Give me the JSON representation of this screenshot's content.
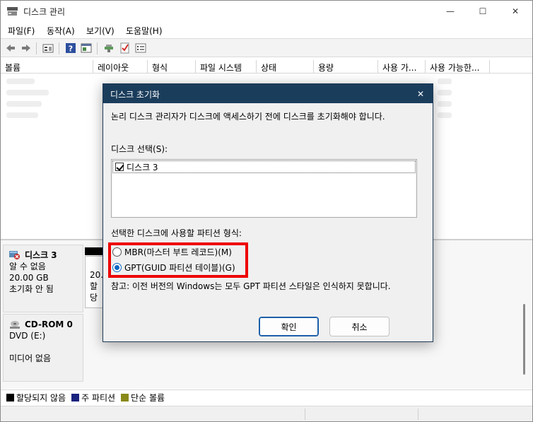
{
  "window": {
    "title": "디스크 관리",
    "min_glyph": "—",
    "max_glyph": "☐",
    "close_glyph": "✕"
  },
  "menu": [
    "파일(F)",
    "동작(A)",
    "보기(V)",
    "도움말(H)"
  ],
  "columns": [
    "볼륨",
    "레이아웃",
    "형식",
    "파일 시스템",
    "상태",
    "용량",
    "사용 가...",
    "사용 가능한..."
  ],
  "disks": [
    {
      "name": "디스크 3",
      "type": "알 수 없음",
      "size": "20.00 GB",
      "state": "초기화 안 됨",
      "icon": "disk-unknown-icon",
      "part_size": "20.",
      "part_state": "할당"
    },
    {
      "name": "CD-ROM 0",
      "type": "DVD (E:)",
      "size": "",
      "state": "미디어 없음",
      "icon": "cdrom-icon"
    }
  ],
  "legend": [
    {
      "label": "할당되지 않음",
      "color": "#000000"
    },
    {
      "label": "주 파티션",
      "color": "#1a237e"
    },
    {
      "label": "단순 볼륨",
      "color": "#8a8a1a"
    }
  ],
  "dialog": {
    "title": "디스크 초기화",
    "close_glyph": "✕",
    "description": "논리 디스크 관리자가 디스크에 액세스하기 전에 디스크를 초기화해야 합니다.",
    "select_label": "디스크 선택(S):",
    "disk_items": [
      {
        "label": "디스크 3",
        "checked": true
      }
    ],
    "partition_label": "선택한 디스크에 사용할 파티션 형식:",
    "options": [
      {
        "label": "MBR(마스터 부트 레코드)(M)",
        "selected": false
      },
      {
        "label": "GPT(GUID 파티션 테이블)(G)",
        "selected": true
      }
    ],
    "note": "참고: 이전 버전의 Windows는 모두 GPT 파티션 스타일은 인식하지 못합니다.",
    "ok_label": "확인",
    "cancel_label": "취소",
    "highlight_color": "#ee0000"
  }
}
